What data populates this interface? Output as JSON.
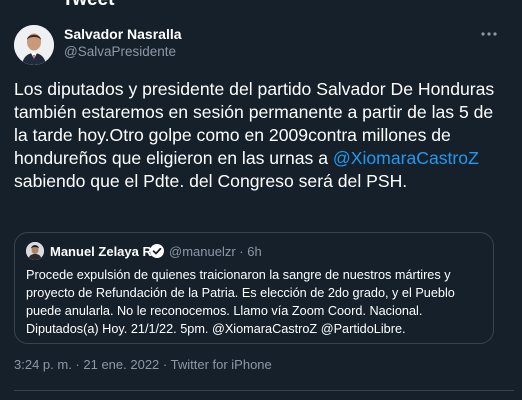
{
  "header": {
    "title": "Tweet"
  },
  "author": {
    "name": "Salvador Nasralla",
    "handle": "@SalvaPresidente"
  },
  "tweet": {
    "text_before_mention": "Los diputados y presidente del partido Salvador De Honduras también estaremos en sesión permanente a partir de las 5 de la tarde hoy.Otro golpe como en 2009contra millones de hondureños que eligieron en las urnas a ",
    "mention": "@XiomaraCastroZ",
    "text_after_mention": " sabiendo que el Pdte. del Congreso será del PSH."
  },
  "quote": {
    "name": "Manuel Zelaya R.",
    "handle": "@manuelzr",
    "separator": " · ",
    "age": "6h",
    "text": "Procede expulsión de quienes traicionaron la sangre de nuestros mártires y proyecto de Refundación de la Patria. Es elección de 2do grado, y el Pueblo puede anularla. No le reconocemos. Llamo vía Zoom Coord. Nacional. Diputados(a) Hoy. 21/1/22. 5pm. @XiomaraCastroZ @PartidoLibre."
  },
  "meta": {
    "time": "3:24 p. m.",
    "separator": " · ",
    "date": "21 ene. 2022",
    "source": "Twitter for iPhone"
  },
  "icons": {
    "more": "more-horizontal-icon",
    "verified": "verified-badge-icon"
  },
  "colors": {
    "background": "#15202b",
    "text": "#ffffff",
    "secondary": "#8b98a5",
    "accent": "#1d9bf0",
    "border": "#38444d"
  }
}
